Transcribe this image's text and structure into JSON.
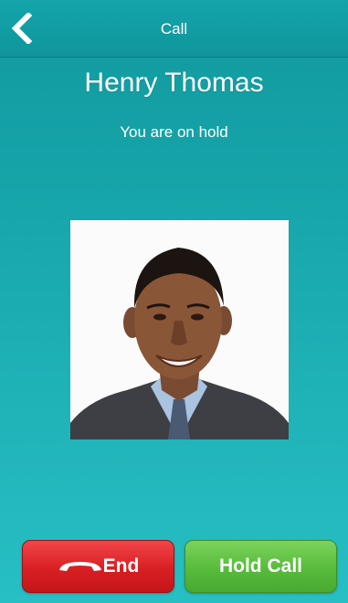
{
  "header": {
    "back_icon": "chevron-left-icon",
    "title": "Call"
  },
  "call": {
    "caller_name": "Henry Thomas",
    "status": "You are on hold"
  },
  "actions": {
    "end_label": "End",
    "end_icon": "phone-hangup-icon",
    "hold_label": "Hold Call"
  },
  "colors": {
    "background": "#17a6ab",
    "end_button": "#d81f23",
    "hold_button": "#58bb3c"
  }
}
